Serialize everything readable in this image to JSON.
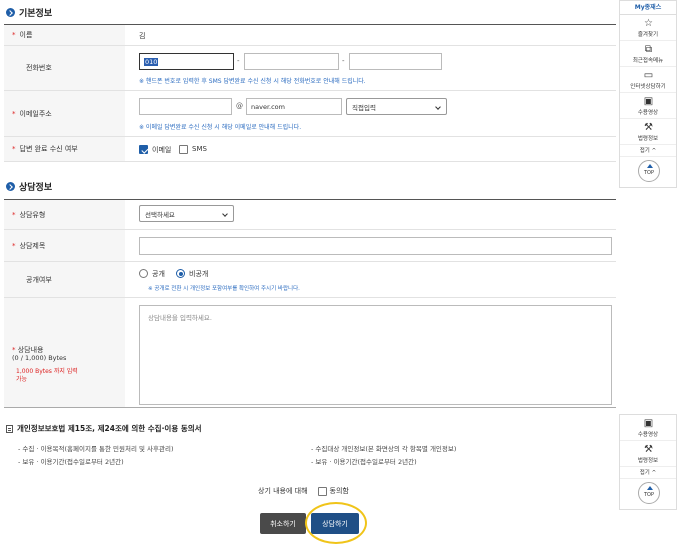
{
  "basic": {
    "title": "기본정보",
    "name_label": "이름",
    "name_value": "김",
    "phone_label": "전화번호",
    "phone_prefix": "010",
    "phone_sep1": "-",
    "phone_sep2": "-",
    "phone_note": "※ 핸드폰 번호로 입력한 후 SMS 답변완료 수신 신청 시 해당 전화번호로 안내해 드립니다.",
    "email_label": "이메일주소",
    "email_at": "@",
    "email_domain": "naver.com",
    "email_select": "직접입력",
    "email_note": "※ 이메일 답변완료 수신 신청 시 해당 이메일로 안내해 드립니다.",
    "notify_label": "답변 완료 수신 여부",
    "notify_email": "이메일",
    "notify_sms": "SMS"
  },
  "consult": {
    "title": "상담정보",
    "type_label": "상담유형",
    "type_select": "선택하세요",
    "subject_label": "상담제목",
    "public_label": "공개여부",
    "public_yes": "공개",
    "public_no": "비공개",
    "public_note": "※ 공개로 전환 시 개인정보 포함여부를 확인하여 주시기 바랍니다.",
    "content_label": "상담내용",
    "content_count": "(0 / 1,000) Bytes",
    "content_limit_1": "1,000 Bytes 까지 입력",
    "content_limit_2": "가능",
    "content_placeholder": "상담내용을 입력하세요."
  },
  "privacy": {
    "title": "개인정보보호법 제15조, 제24조에 의한 수집·이용 동의서",
    "purpose": "- 수집 · 이용목적(홈페이지를 통한 민원처리 및 사후관리)",
    "retention_left": "- 보유 · 이용기간(접수일로부터 2년간)",
    "items": "- 수집대상 개인정보(본 화면상의 각 항목별 개인정보)",
    "retention_right": "- 보유 · 이용기간(접수일로부터 2년간)",
    "agree_text": "상기 내용에 대해",
    "agree_checkbox": "동의함"
  },
  "actions": {
    "cancel": "취소하기",
    "submit": "상담하기"
  },
  "quick_menu_top": {
    "head": "My종재스",
    "items": [
      {
        "label": "즐겨찾기",
        "icon": "star-icon"
      },
      {
        "label": "최근접속메뉴",
        "icon": "recent-icon"
      },
      {
        "label": "인터넷상담하기",
        "icon": "laptop-icon"
      },
      {
        "label": "수용영상",
        "icon": "video-icon"
      },
      {
        "label": "법령정보",
        "icon": "gavel-icon"
      }
    ],
    "fold": "접기 ^",
    "top": "TOP"
  },
  "quick_menu_bottom": {
    "items": [
      {
        "label": "수용영상",
        "icon": "video-icon"
      },
      {
        "label": "법령정보",
        "icon": "gavel-icon"
      }
    ],
    "fold": "접기 ^",
    "top": "TOP"
  },
  "colors": {
    "accent": "#1f5ea8",
    "required": "#dd2222",
    "note": "#2a6bc0",
    "highlight": "#f0c419"
  }
}
